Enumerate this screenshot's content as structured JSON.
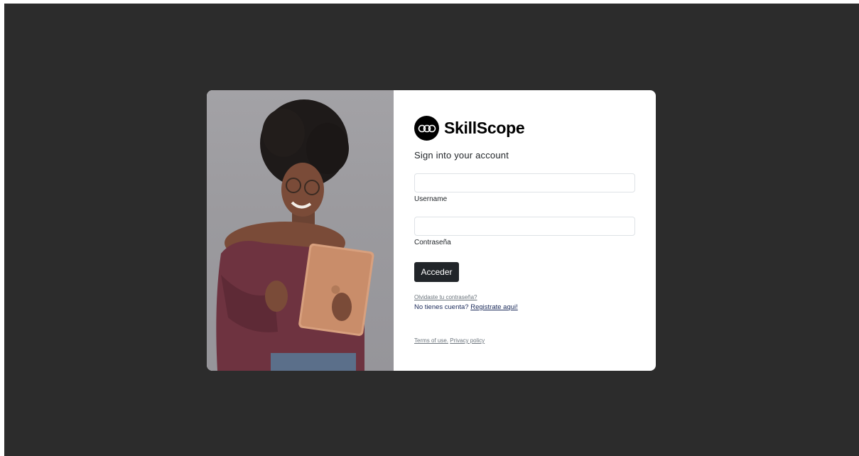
{
  "brand": {
    "name": "SkillScope",
    "logo_icon": "skillscope-logo-icon"
  },
  "form": {
    "title": "Sign into your account",
    "username": {
      "label": "Username",
      "value": "",
      "placeholder": ""
    },
    "password": {
      "label": "Contraseña",
      "value": "",
      "placeholder": ""
    },
    "submit_label": "Acceder",
    "forgot_label": "Olvidaste tu contraseña?",
    "no_account_text": "No tienes cuenta?",
    "register_link": "Registrate aqui!"
  },
  "footer": {
    "terms_label": "Terms of use.",
    "privacy_label": "Privacy policy"
  },
  "colors": {
    "backdrop": "#2c2c2c",
    "button": "#212529",
    "link": "#1a2a5a"
  }
}
